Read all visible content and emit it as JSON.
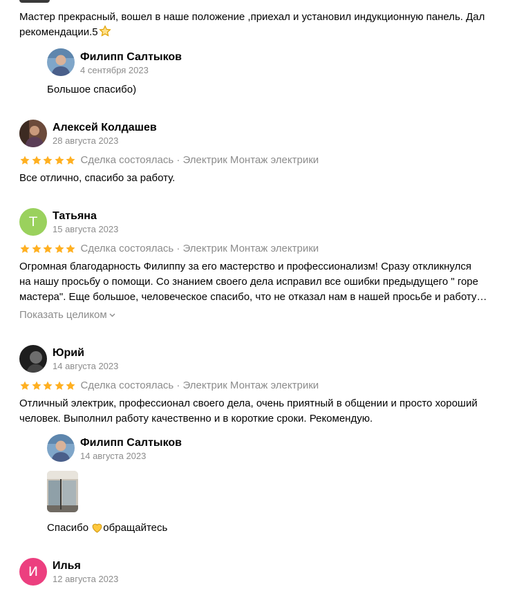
{
  "review_top": {
    "text": "Мастер прекрасный, вошел в наше положение ,приехал и установил индукционную панель. Дал",
    "text_line2": "рекомендации.5",
    "reply": {
      "name": "Филипп Салтыков",
      "date": "4 сентября 2023",
      "text": "Большое спасибо)"
    }
  },
  "reviews": [
    {
      "name": "Алексей Колдашев",
      "date": "28 августа 2023",
      "rating": 5,
      "deal": "Сделка состоялась · Электрик Монтаж электрики",
      "text": "Все отлично, спасибо за работу."
    },
    {
      "name": "Татьяна",
      "date": "15 августа 2023",
      "rating": 5,
      "avatar_letter": "Т",
      "deal": "Сделка состоялась · Электрик Монтаж электрики",
      "text_lines": [
        "Огромная благодарность Филиппу за его мастерство и профессионализм! Сразу откликнулся",
        "на нашу просьбу о помощи. Со знанием своего дела исправил все ошибки предыдущего \" горе",
        "мастера\". Еще большое, человеческое спасибо, что не отказал нам в нашей просьбе и работу…"
      ],
      "show_more": "Показать целиком"
    },
    {
      "name": "Юрий",
      "date": "14 августа 2023",
      "rating": 5,
      "deal": "Сделка состоялась · Электрик Монтаж электрики",
      "text_lines": [
        "Отличный электрик, профессионал своего дела, очень приятный в общении и просто хороший",
        "человек. Выполнил работу качественно и в короткие сроки. Рекомендую."
      ],
      "reply": {
        "name": "Филипп Салтыков",
        "date": "14 августа 2023",
        "text_before": "Спасибо",
        "text_after": "обращайтесь"
      }
    },
    {
      "name": "Илья",
      "date": "12 августа 2023",
      "avatar_letter": "И"
    }
  ],
  "colors": {
    "star": "#ffb021",
    "muted": "#8c8c8c",
    "avatar_t": "#9ad15d",
    "avatar_i": "#ec3f7f"
  },
  "icons": [
    "star-outline-icon",
    "star-icon",
    "heart-icon",
    "chevron-down-icon"
  ]
}
